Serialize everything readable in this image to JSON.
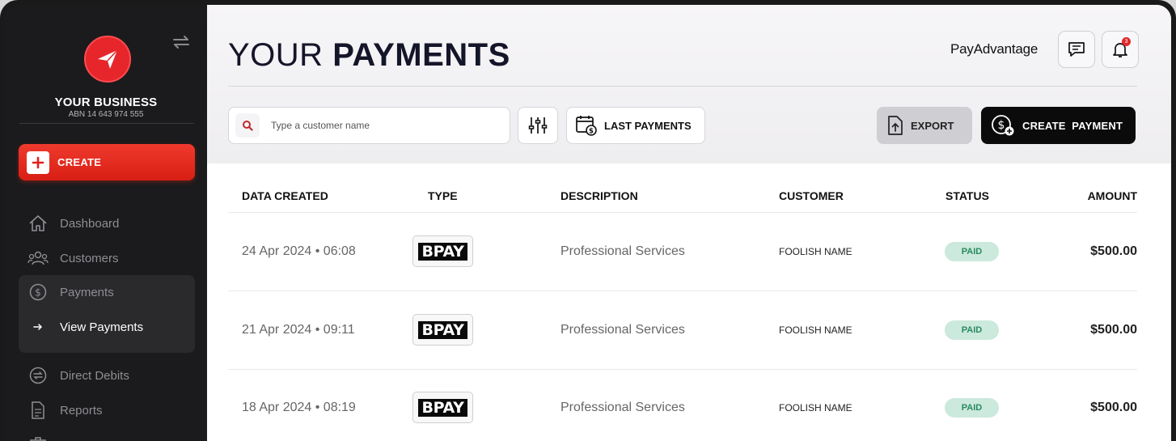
{
  "sidebar": {
    "business_name": "YOUR BUSINESS",
    "abn": "ABN 14 643 974 555",
    "create_label": "CREATE",
    "items": [
      {
        "label": "Dashboard",
        "icon": "home-icon"
      },
      {
        "label": "Customers",
        "icon": "users-icon"
      },
      {
        "label": "Payments",
        "icon": "dollar-circle-icon"
      },
      {
        "label": "View Payments",
        "icon": "arrow-right-icon"
      },
      {
        "label": "Direct Debits",
        "icon": "refresh-dollar-icon"
      },
      {
        "label": "Reports",
        "icon": "document-icon"
      }
    ]
  },
  "header": {
    "title_light": "YOUR ",
    "title_bold": "PAYMENTS",
    "brand": "PayAdvantage",
    "notification_count": "3"
  },
  "toolbar": {
    "search_placeholder": "Type a customer name",
    "last_payments_label": "LAST PAYMENTS",
    "export_label": "EXPORT",
    "create_payment_label": "CREATE  PAYMENT"
  },
  "table": {
    "columns": [
      "DATA CREATED",
      "TYPE",
      "DESCRIPTION",
      "CUSTOMER",
      "STATUS",
      "AMOUNT"
    ],
    "rows": [
      {
        "date": "24 Apr 2024 • 06:08",
        "type": "BPAY",
        "description": "Professional Services",
        "customer": "FOOLISH NAME",
        "status": "PAID",
        "amount": "$500.00"
      },
      {
        "date": "21 Apr 2024 • 09:11",
        "type": "BPAY",
        "description": "Professional Services",
        "customer": "FOOLISH NAME",
        "status": "PAID",
        "amount": "$500.00"
      },
      {
        "date": "18 Apr 2024 • 08:19",
        "type": "BPAY",
        "description": "Professional Services",
        "customer": "FOOLISH NAME",
        "status": "PAID",
        "amount": "$500.00"
      }
    ]
  },
  "colors": {
    "accent_red": "#e6262b",
    "status_paid_bg": "#cbe9dc",
    "status_paid_text": "#2b8a62"
  }
}
